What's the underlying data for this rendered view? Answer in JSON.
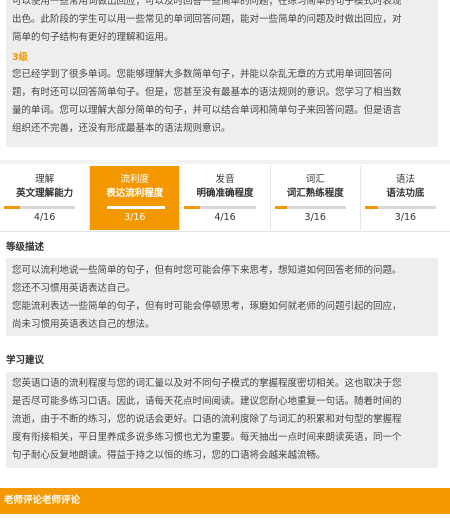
{
  "level_intro": {
    "lines": [
      "可以使用一些常用词做出回应；可以及时回答一些简单的问题；在练习简单的句子模式时表现",
      "出色。此阶段的学生可以用一些常见的单词回答问题，能对一些简单的问题及时做出回应，对",
      "简单的句子结构有更好的理解和运用。"
    ]
  },
  "level3": {
    "title": "3级",
    "lines": [
      "您已经学到了很多单词。您能够理解大多数简单句子，并能以杂乱无章的方式用单词回答问",
      "题，有时还可以回答简单句子。但是，您甚至没有最基本的语法规则的意识。您学习了相当数",
      "量的单词。您可以理解大部分简单的句子，并可以结合单词和简单句子来回答问题。但是语言",
      "组织还不完善，还没有形成最基本的语法规则意识。"
    ]
  },
  "tabs": [
    {
      "label1": "理解",
      "label2": "英文理解能力",
      "score": "4/16",
      "progress": 0.22
    },
    {
      "label1": "流利度",
      "label2": "表达流利程度",
      "score": "3/16",
      "progress": 0.18
    },
    {
      "label1": "发音",
      "label2": "明确准确程度",
      "score": "4/16",
      "progress": 0.22
    },
    {
      "label1": "词汇",
      "label2": "词汇熟练程度",
      "score": "3/16",
      "progress": 0.18
    },
    {
      "label1": "语法",
      "label2": "语法功底",
      "score": "3/16",
      "progress": 0.18
    }
  ],
  "level_desc": {
    "heading": "等级描述",
    "lines": [
      "您可以流利地说一些简单的句子，但有时您可能会停下来思考，想知道如何回答老师的问题。",
      "您还不习惯用英语表达自己。",
      "您能流利表达一些简单的句子，但有时可能会停顿思考，琢磨如何就老师的问题引起的回应，",
      "尚未习惯用英语表达自己的想法。"
    ]
  },
  "advice": {
    "heading": "学习建议",
    "lines": [
      "您英语口语的流利程度与您的词汇量以及对不同句子模式的掌握程度密切相关。这也取决于您",
      "是否尽可能多练习口语。因此，请每天花点时间阅读。建议您耐心地重复一句话。随着时间的",
      "流逝，由于不断的练习，您的说话会更好。口语的流利度除了与词汇的积累和对句型的掌握程",
      "度有衔接相关，平日里养成多说多练习惯也尤为重要。每天抽出一点时间来朗读英语，同一个",
      "句子耐心反复地朗读。得益于持之以恒的练习，您的口语将会越来越流畅。"
    ]
  },
  "footer": {
    "badge": "老师",
    "title": "评论老师评论"
  },
  "colors": {
    "accent": "#f39800",
    "panel": "#eeeeee"
  }
}
